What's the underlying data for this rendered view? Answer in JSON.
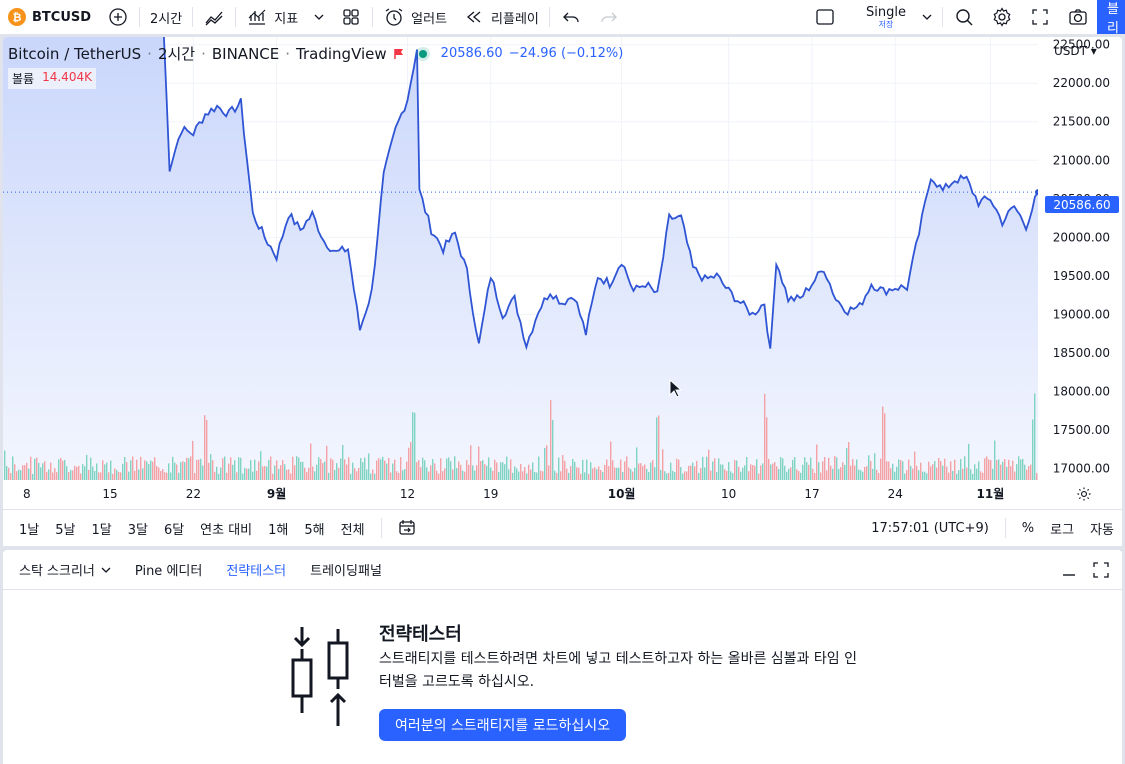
{
  "toolbar": {
    "symbol": "BTCUSD",
    "interval": "2시간",
    "indicators": "지표",
    "alert": "얼러트",
    "replay": "리플레이",
    "layout_name": "Single",
    "layout_sub": "저장",
    "publish": "퍼블리시"
  },
  "legend": {
    "pair": "Bitcoin / TetherUS",
    "interval": "2시간",
    "exchange": "BINANCE",
    "source": "TradingView",
    "dot": "·",
    "last": "20586.60",
    "change": "−24.96 (−0.12%)",
    "volume_label": "볼륨",
    "volume_value": "14.404K"
  },
  "chart": {
    "currency": "USDT",
    "current_price_tag": "20586.60",
    "colors": {
      "line": "#2f55d4",
      "area_top": "#c9d6fb",
      "area_bottom": "#f3f6fe",
      "vol_up": "#7fd3c2",
      "vol_down": "#f4a1a6",
      "price_tag": "#2962ff"
    }
  },
  "chart_data": {
    "type": "area",
    "title": "Bitcoin / TetherUS · 2시간 · BINANCE",
    "ylabel": "",
    "xlabel": "",
    "ylim": [
      16850,
      22600
    ],
    "y_ticks": [
      "22500.00",
      "22000.00",
      "21500.00",
      "21000.00",
      "20500.00",
      "20000.00",
      "19500.00",
      "19000.00",
      "18500.00",
      "18000.00",
      "17500.00",
      "17000.00"
    ],
    "x_ticks": [
      {
        "label": "8",
        "x": 8,
        "bold": false
      },
      {
        "label": "15",
        "x": 15,
        "bold": false
      },
      {
        "label": "22",
        "x": 22,
        "bold": false
      },
      {
        "label": "9월",
        "x": 29,
        "bold": true
      },
      {
        "label": "12",
        "x": 40,
        "bold": false
      },
      {
        "label": "19",
        "x": 47,
        "bold": false
      },
      {
        "label": "10월",
        "x": 58,
        "bold": true
      },
      {
        "label": "10",
        "x": 67,
        "bold": false
      },
      {
        "label": "17",
        "x": 74,
        "bold": false
      },
      {
        "label": "24",
        "x": 81,
        "bold": false
      },
      {
        "label": "11월",
        "x": 89,
        "bold": true
      }
    ],
    "x": [
      6,
      16,
      19.5,
      20,
      21,
      22,
      23,
      24,
      25,
      26,
      27,
      28,
      29,
      30,
      31,
      32,
      33,
      34,
      35,
      36,
      37,
      38,
      39,
      40,
      40.8,
      41,
      42,
      43,
      44,
      45,
      46,
      47,
      48,
      49,
      50,
      51,
      52,
      53,
      54,
      55,
      56,
      57,
      58,
      59,
      60,
      61,
      62,
      63,
      64,
      65,
      66,
      67,
      68,
      69,
      70,
      70.5,
      71,
      72,
      73,
      74,
      75,
      76,
      77,
      78,
      79,
      80,
      81,
      82,
      83,
      84,
      85,
      86,
      87,
      88,
      89,
      90,
      91,
      92,
      93
    ],
    "series": [
      {
        "name": "BTCUSDT",
        "values": [
          22700,
          22700,
          22700,
          20900,
          21400,
          21350,
          21600,
          21700,
          21600,
          21750,
          20300,
          20000,
          19750,
          20300,
          20100,
          20300,
          19950,
          19800,
          19850,
          18800,
          19300,
          20800,
          21400,
          21800,
          22450,
          20600,
          20100,
          19850,
          20050,
          19550,
          18600,
          19500,
          19000,
          19200,
          18600,
          19050,
          19300,
          19150,
          19250,
          18750,
          19500,
          19400,
          19700,
          19300,
          19400,
          19250,
          20250,
          20250,
          19600,
          19450,
          19500,
          19300,
          19150,
          19000,
          19150,
          18500,
          19700,
          19200,
          19200,
          19400,
          19600,
          19200,
          19050,
          19100,
          19400,
          19300,
          19350,
          19350,
          20050,
          20800,
          20600,
          20750,
          20750,
          20450,
          20500,
          20200,
          20400,
          20150,
          20586.6
        ]
      }
    ],
    "volume": {
      "note": "Bars drawn with a deterministic pseudo-random pattern; tallest spikes near 9월 12, 10월 13 and 11월 8",
      "spike_positions": [
        23,
        40.5,
        52,
        61,
        70,
        80,
        92.5
      ]
    },
    "grid": true,
    "last_value_line": 20586.6
  },
  "range_bar": {
    "ranges": [
      "1날",
      "5날",
      "1달",
      "3달",
      "6달",
      "연초 대비",
      "1해",
      "5해",
      "전체"
    ],
    "time": "17:57:01 (UTC+9)",
    "percent": "%",
    "log": "로그",
    "auto": "자동"
  },
  "bottom_panel": {
    "tabs": [
      "스탁 스크리너",
      "Pine 에디터",
      "전략테스터",
      "트레이딩패널"
    ],
    "active_tab": 2,
    "strategy_title": "전략테스터",
    "strategy_desc": "스트래티지를 테스트하려면 차트에 넣고 테스트하고자 하는 올바른 심볼과 타임 인터벌을 고르도록 하십시오.",
    "strategy_button": "여러분의 스트래티지를 로드하십시오"
  }
}
